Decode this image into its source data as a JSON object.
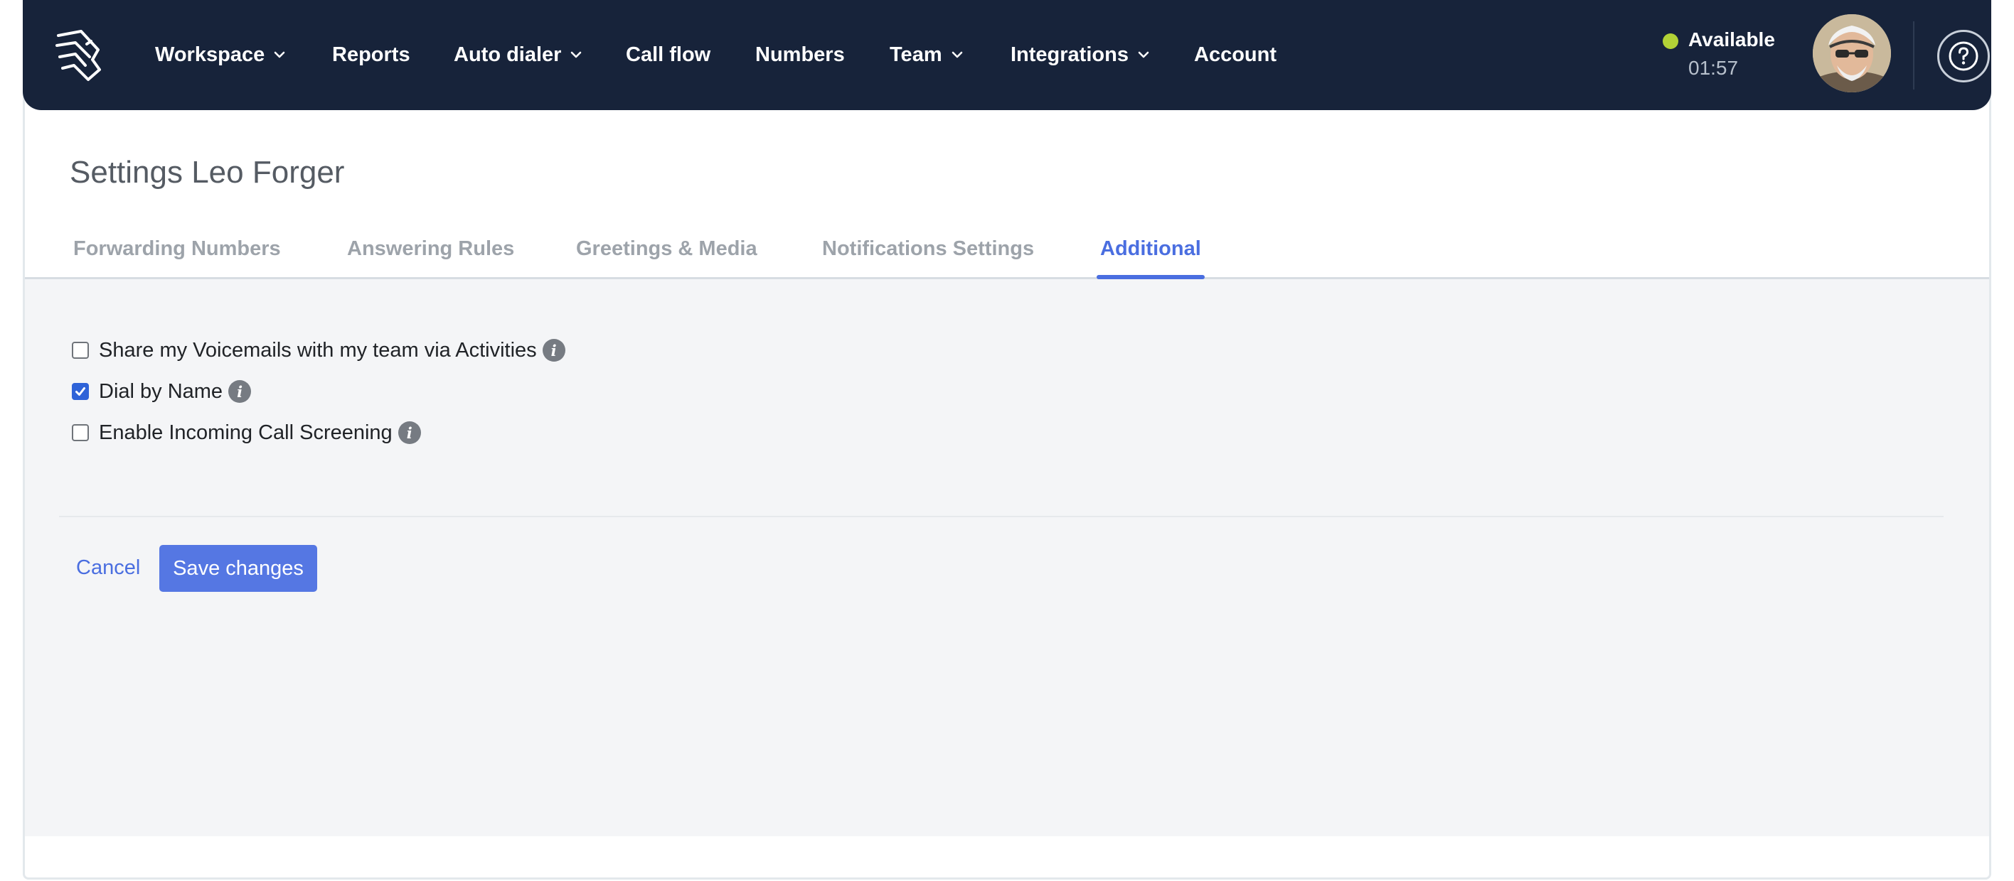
{
  "nav": {
    "items": [
      {
        "label": "Workspace",
        "dropdown": true
      },
      {
        "label": "Reports",
        "dropdown": false
      },
      {
        "label": "Auto dialer",
        "dropdown": true
      },
      {
        "label": "Call flow",
        "dropdown": false
      },
      {
        "label": "Numbers",
        "dropdown": false
      },
      {
        "label": "Team",
        "dropdown": true
      },
      {
        "label": "Integrations",
        "dropdown": true
      },
      {
        "label": "Account",
        "dropdown": false
      }
    ],
    "status": {
      "label": "Available",
      "timer": "01:57",
      "color": "#b2d236"
    },
    "help_icon": "question-circle-icon",
    "brand_color": "#17233a"
  },
  "page": {
    "title": "Settings Leo Forger",
    "tabs": [
      {
        "label": "Forwarding Numbers",
        "active": false
      },
      {
        "label": "Answering Rules",
        "active": false
      },
      {
        "label": "Greetings & Media",
        "active": false
      },
      {
        "label": "Notifications Settings",
        "active": false
      },
      {
        "label": "Additional",
        "active": true
      }
    ],
    "accent_color": "#4a6ee0"
  },
  "options": [
    {
      "label": "Share my Voicemails with my team via Activities",
      "checked": false,
      "info_icon": "info-icon"
    },
    {
      "label": "Dial by Name",
      "checked": true,
      "info_icon": "info-icon"
    },
    {
      "label": "Enable Incoming Call Screening",
      "checked": false,
      "info_icon": "info-icon"
    }
  ],
  "actions": {
    "cancel_label": "Cancel",
    "save_label": "Save changes"
  }
}
